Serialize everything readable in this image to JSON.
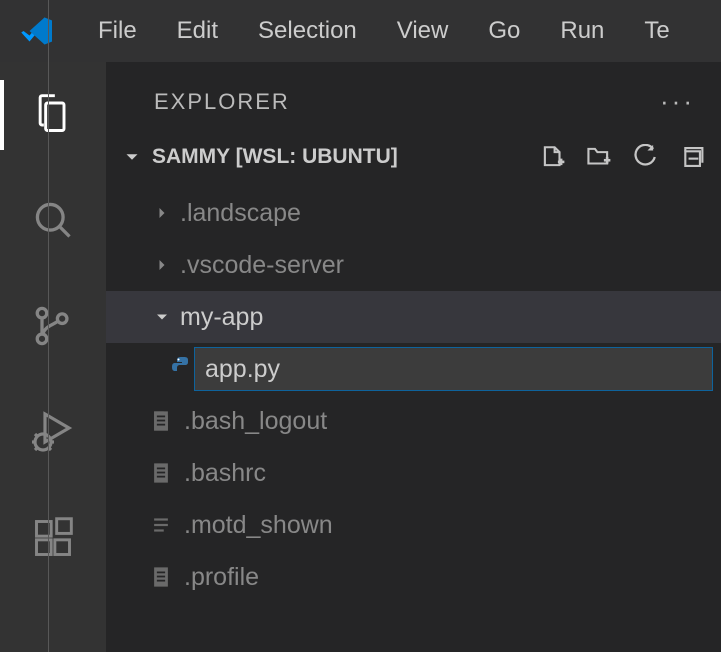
{
  "menubar": {
    "items": [
      "File",
      "Edit",
      "Selection",
      "View",
      "Go",
      "Run",
      "Te"
    ]
  },
  "sidebar": {
    "title": "EXPLORER",
    "section_title": "SAMMY [WSL: UBUNTU]"
  },
  "tree": {
    "items": [
      {
        "name": ".landscape",
        "type": "folder",
        "expanded": false,
        "depth": 0
      },
      {
        "name": ".vscode-server",
        "type": "folder",
        "expanded": false,
        "depth": 0
      },
      {
        "name": "my-app",
        "type": "folder",
        "expanded": true,
        "depth": 0,
        "selected": true
      },
      {
        "name": "app.py",
        "type": "rename-input",
        "depth": 1,
        "icon": "python"
      },
      {
        "name": ".bash_logout",
        "type": "file",
        "depth": 0
      },
      {
        "name": ".bashrc",
        "type": "file",
        "depth": 0
      },
      {
        "name": ".motd_shown",
        "type": "file",
        "depth": 0
      },
      {
        "name": ".profile",
        "type": "file",
        "depth": 0
      }
    ]
  },
  "rename_value": "app.py"
}
